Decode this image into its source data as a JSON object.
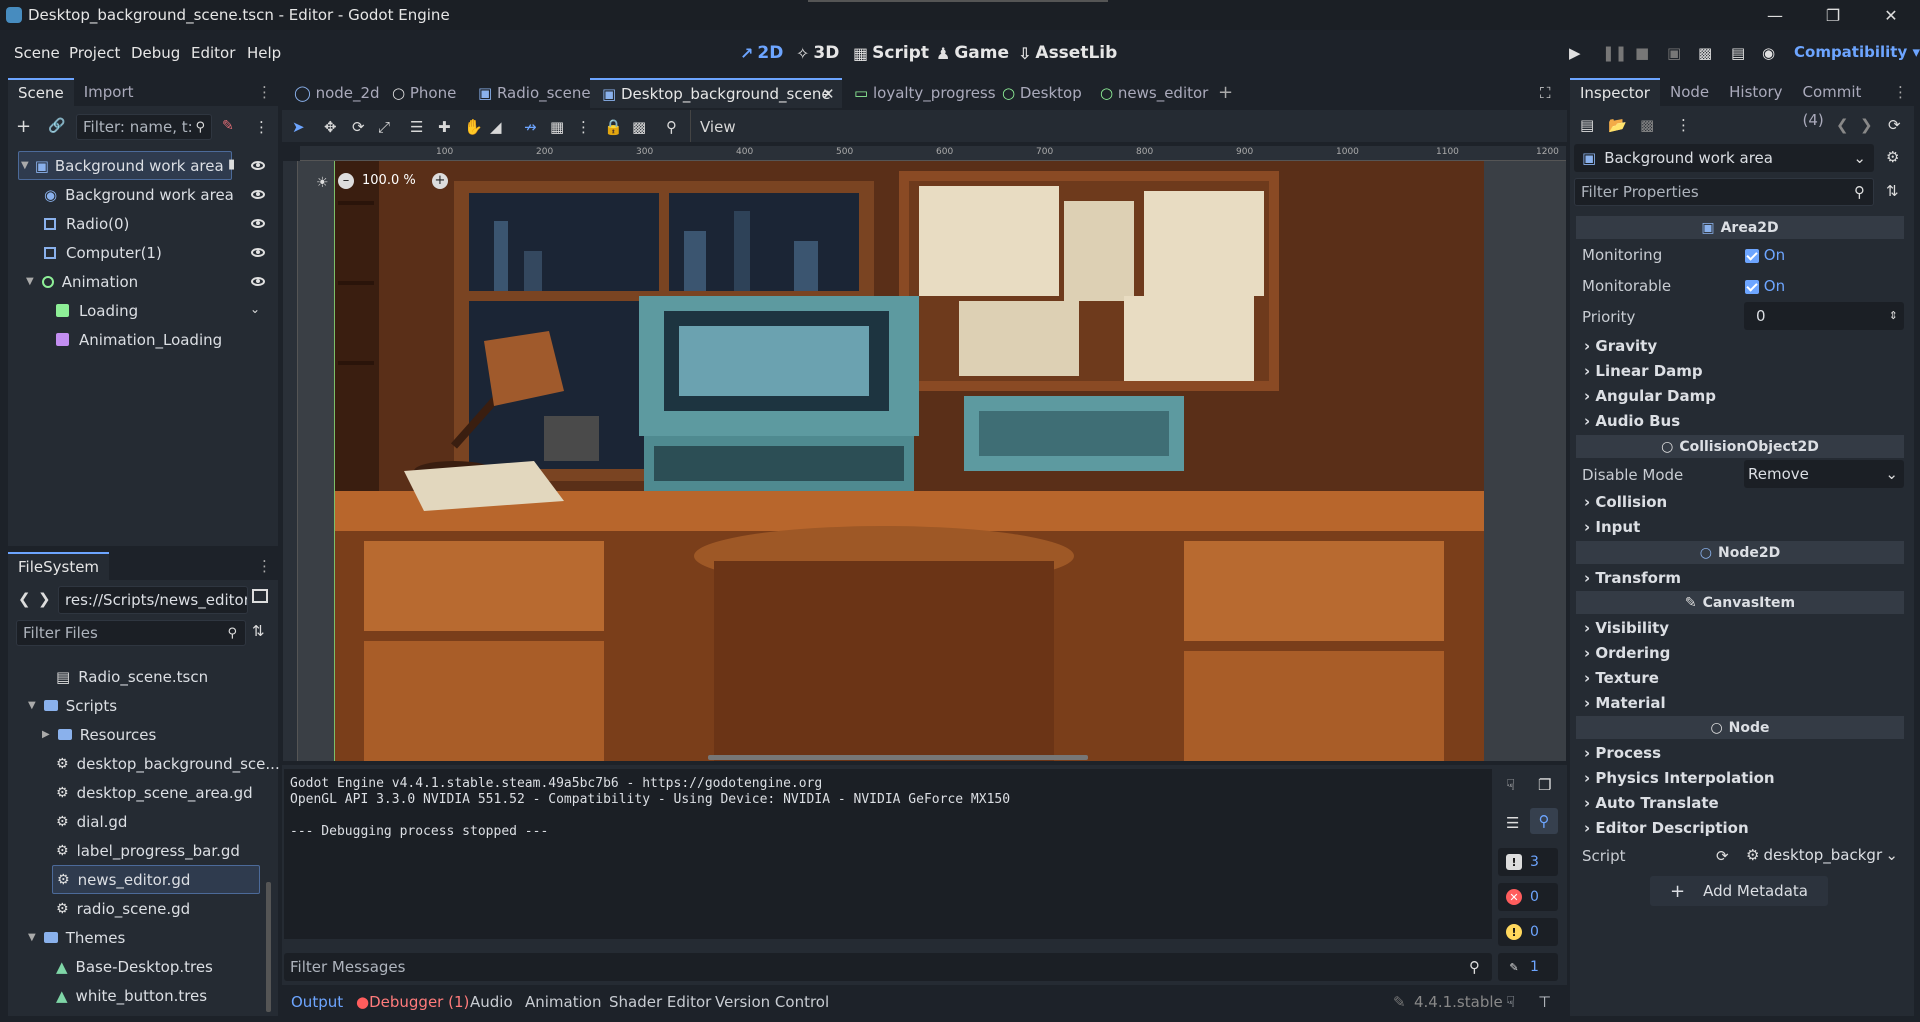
{
  "window": {
    "title": "Desktop_background_scene.tscn - Editor - Godot Engine"
  },
  "menus": [
    "Scene",
    "Project",
    "Debug",
    "Editor",
    "Help"
  ],
  "workspaces": [
    {
      "label": "2D",
      "active": true
    },
    {
      "label": "3D",
      "active": false
    },
    {
      "label": "Script",
      "active": false
    },
    {
      "label": "Game",
      "active": false
    },
    {
      "label": "AssetLib",
      "active": false
    }
  ],
  "renderer": "Compatibility",
  "scene_dock": {
    "tabs": [
      "Scene",
      "Import"
    ],
    "filter_placeholder": "Filter: name, t:t",
    "nodes": [
      {
        "label": "Background work area",
        "icon": "area2d-icon",
        "selected": true,
        "depth": 0
      },
      {
        "label": "Background work area",
        "icon": "sprite-icon",
        "depth": 1
      },
      {
        "label": "Radio(0)",
        "icon": "control-icon",
        "depth": 1
      },
      {
        "label": "Computer(1)",
        "icon": "control-icon",
        "depth": 1
      },
      {
        "label": "Animation",
        "icon": "node-icon",
        "depth": 1
      },
      {
        "label": "Loading",
        "icon": "sprite-icon",
        "depth": 2
      },
      {
        "label": "Animation_Loading",
        "icon": "animation-icon",
        "depth": 2
      }
    ]
  },
  "filesystem": {
    "tab": "FileSystem",
    "path": "res://Scripts/news_editor.g",
    "filter_placeholder": "Filter Files",
    "items": [
      {
        "label": "Radio_scene.tscn",
        "type": "scene",
        "depth": 2
      },
      {
        "label": "Scripts",
        "type": "folder",
        "depth": 1,
        "open": true
      },
      {
        "label": "Resources",
        "type": "folder",
        "depth": 2
      },
      {
        "label": "desktop_background_sce...",
        "type": "script",
        "depth": 2
      },
      {
        "label": "desktop_scene_area.gd",
        "type": "script",
        "depth": 2
      },
      {
        "label": "dial.gd",
        "type": "script",
        "depth": 2
      },
      {
        "label": "label_progress_bar.gd",
        "type": "script",
        "depth": 2
      },
      {
        "label": "news_editor.gd",
        "type": "script",
        "depth": 2,
        "selected": true
      },
      {
        "label": "radio_scene.gd",
        "type": "script",
        "depth": 2
      },
      {
        "label": "Themes",
        "type": "folder",
        "depth": 1,
        "open": true
      },
      {
        "label": "Base-Desktop.tres",
        "type": "theme",
        "depth": 2
      },
      {
        "label": "white_button.tres",
        "type": "theme",
        "depth": 2
      }
    ]
  },
  "scene_tabs": [
    "node_2d",
    "Phone",
    "Radio_scene",
    "Desktop_background_scene",
    "loyalty_progress",
    "Desktop",
    "news_editor"
  ],
  "active_scene_tab": "Desktop_background_scene",
  "viewport": {
    "view_label": "View",
    "zoom": "100.0 %",
    "ruler_ticks": [
      "100",
      "200",
      "300",
      "400",
      "500",
      "600",
      "700",
      "800",
      "900",
      "1000",
      "1100",
      "1200"
    ]
  },
  "output": {
    "lines": [
      "Godot Engine v4.4.1.stable.steam.49a5bc7b6 - https://godotengine.org",
      "OpenGL API 3.3.0 NVIDIA 551.52 - Compatibility - Using Device: NVIDIA - NVIDIA GeForce MX150",
      "",
      "--- Debugging process stopped ---"
    ],
    "counts": {
      "messages": "3",
      "errors": "0",
      "warnings": "0",
      "editor": "1"
    },
    "filter_placeholder": "Filter Messages"
  },
  "bottom_tabs": [
    "Output",
    "Debugger (1)",
    "Audio",
    "Animation",
    "Shader Editor",
    "Version Control"
  ],
  "version": "4.4.1.stable",
  "inspector": {
    "tabs": [
      "Inspector",
      "Node",
      "History",
      "Commit (4)"
    ],
    "object": "Background work area",
    "filter_placeholder": "Filter Properties",
    "area2d": "Area2D",
    "monitoring_label": "Monitoring",
    "monitoring_value": "On",
    "monitorable_label": "Monitorable",
    "monitorable_value": "On",
    "priority_label": "Priority",
    "priority_value": "0",
    "groups1": [
      "Gravity",
      "Linear Damp",
      "Angular Damp",
      "Audio Bus"
    ],
    "collision_object": "CollisionObject2D",
    "disable_mode_label": "Disable Mode",
    "disable_mode_value": "Remove",
    "groups2": [
      "Collision",
      "Input"
    ],
    "node2d": "Node2D",
    "groups3": [
      "Transform"
    ],
    "canvas_item": "CanvasItem",
    "groups4": [
      "Visibility",
      "Ordering",
      "Texture",
      "Material"
    ],
    "node": "Node",
    "groups5": [
      "Process",
      "Physics Interpolation",
      "Auto Translate",
      "Editor Description"
    ],
    "script_label": "Script",
    "script_value": "desktop_backgr",
    "add_metadata": "Add Metadata"
  },
  "colors": {
    "accent": "#6da5ff",
    "bg": "#1d2229",
    "panel": "#252b33"
  }
}
